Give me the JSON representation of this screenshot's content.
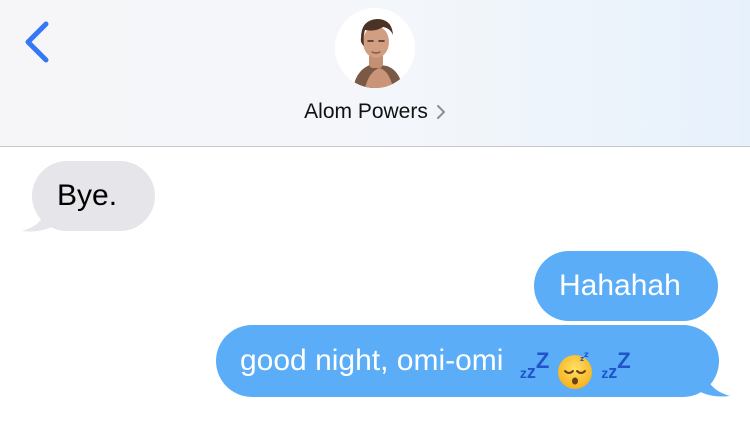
{
  "header": {
    "contact_name": "Alom Powers",
    "back_icon": "chevron-left-icon",
    "detail_icon": "chevron-right-icon",
    "accent_color": "#3478f6"
  },
  "messages": [
    {
      "direction": "incoming",
      "text": "Bye."
    },
    {
      "direction": "outgoing",
      "text": "Hahahah"
    },
    {
      "direction": "outgoing",
      "text": "good night, omi-omi",
      "emoji": [
        "zzz",
        "sleeping-face",
        "zzz"
      ]
    }
  ],
  "colors": {
    "incoming_bubble": "#e5e5ea",
    "outgoing_bubble": "#5aadf6"
  }
}
